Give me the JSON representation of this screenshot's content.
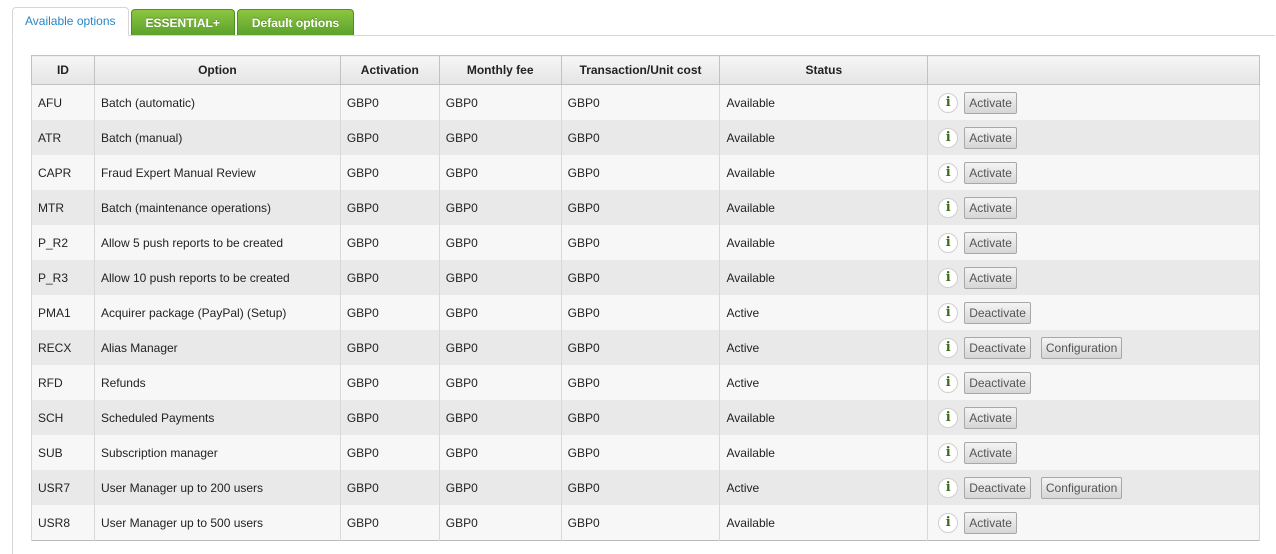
{
  "tabs": [
    {
      "label": "Available options",
      "active": true
    },
    {
      "label": "ESSENTIAL+",
      "active": false
    },
    {
      "label": "Default options",
      "active": false
    }
  ],
  "table": {
    "headers": [
      "ID",
      "Option",
      "Activation",
      "Monthly fee",
      "Transaction/Unit cost",
      "Status",
      ""
    ],
    "rows": [
      {
        "id": "AFU",
        "option": "Batch (automatic)",
        "activation": "GBP0",
        "monthly": "GBP0",
        "unit": "GBP0",
        "status": "Available",
        "action": "Activate",
        "config": ""
      },
      {
        "id": "ATR",
        "option": "Batch (manual)",
        "activation": "GBP0",
        "monthly": "GBP0",
        "unit": "GBP0",
        "status": "Available",
        "action": "Activate",
        "config": ""
      },
      {
        "id": "CAPR",
        "option": "Fraud Expert Manual Review",
        "activation": "GBP0",
        "monthly": "GBP0",
        "unit": "GBP0",
        "status": "Available",
        "action": "Activate",
        "config": ""
      },
      {
        "id": "MTR",
        "option": "Batch (maintenance operations)",
        "activation": "GBP0",
        "monthly": "GBP0",
        "unit": "GBP0",
        "status": "Available",
        "action": "Activate",
        "config": ""
      },
      {
        "id": "P_R2",
        "option": "Allow 5 push reports to be created",
        "activation": "GBP0",
        "monthly": "GBP0",
        "unit": "GBP0",
        "status": "Available",
        "action": "Activate",
        "config": ""
      },
      {
        "id": "P_R3",
        "option": "Allow 10 push reports to be created",
        "activation": "GBP0",
        "monthly": "GBP0",
        "unit": "GBP0",
        "status": "Available",
        "action": "Activate",
        "config": ""
      },
      {
        "id": "PMA1",
        "option": "Acquirer package (PayPal) (Setup)",
        "activation": "GBP0",
        "monthly": "GBP0",
        "unit": "GBP0",
        "status": "Active",
        "action": "Deactivate",
        "config": ""
      },
      {
        "id": "RECX",
        "option": "Alias Manager",
        "activation": "GBP0",
        "monthly": "GBP0",
        "unit": "GBP0",
        "status": "Active",
        "action": "Deactivate",
        "config": "Configuration"
      },
      {
        "id": "RFD",
        "option": "Refunds",
        "activation": "GBP0",
        "monthly": "GBP0",
        "unit": "GBP0",
        "status": "Active",
        "action": "Deactivate",
        "config": ""
      },
      {
        "id": "SCH",
        "option": "Scheduled Payments",
        "activation": "GBP0",
        "monthly": "GBP0",
        "unit": "GBP0",
        "status": "Available",
        "action": "Activate",
        "config": ""
      },
      {
        "id": "SUB",
        "option": "Subscription manager",
        "activation": "GBP0",
        "monthly": "GBP0",
        "unit": "GBP0",
        "status": "Available",
        "action": "Activate",
        "config": ""
      },
      {
        "id": "USR7",
        "option": "User Manager up to 200 users",
        "activation": "GBP0",
        "monthly": "GBP0",
        "unit": "GBP0",
        "status": "Active",
        "action": "Deactivate",
        "config": "Configuration"
      },
      {
        "id": "USR8",
        "option": "User Manager up to 500 users",
        "activation": "GBP0",
        "monthly": "GBP0",
        "unit": "GBP0",
        "status": "Available",
        "action": "Activate",
        "config": ""
      }
    ]
  },
  "icons": {
    "info": "info-icon"
  },
  "colors": {
    "tab_green": "#6ab033",
    "tab_active_text": "#2a86c4",
    "info_green": "#3a6b1a"
  }
}
